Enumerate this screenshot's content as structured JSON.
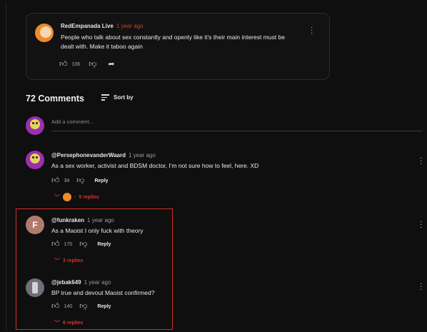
{
  "pinned": {
    "author": "RedEmpanada Live",
    "time": "1 year ago",
    "text": "People who talk about sex constantly and openly like it's their main interest must be dealt with. Make it taboo again",
    "likes": "106"
  },
  "header": {
    "count": "72 Comments",
    "sort_label": "Sort by"
  },
  "add_comment": {
    "placeholder": "Add a comment..."
  },
  "comments": [
    {
      "author": "@PersephonevanderWaard",
      "time": "1 year ago",
      "text": "As a sex worker, activist and BDSM doctor, I'm not sure how to feel, here. XD",
      "likes": "34",
      "reply_label": "Reply",
      "replies": "5 replies"
    },
    {
      "author": "@funkraken",
      "time": "1 year ago",
      "text": "As a Maoist I only fuck with theory",
      "likes": "170",
      "reply_label": "Reply",
      "replies": "3 replies",
      "avatar_letter": "F"
    },
    {
      "author": "@jebak649",
      "time": "1 year ago",
      "text": "BP true and devout Maoist confirmed?",
      "likes": "140",
      "reply_label": "Reply",
      "replies": "6 replies"
    }
  ]
}
